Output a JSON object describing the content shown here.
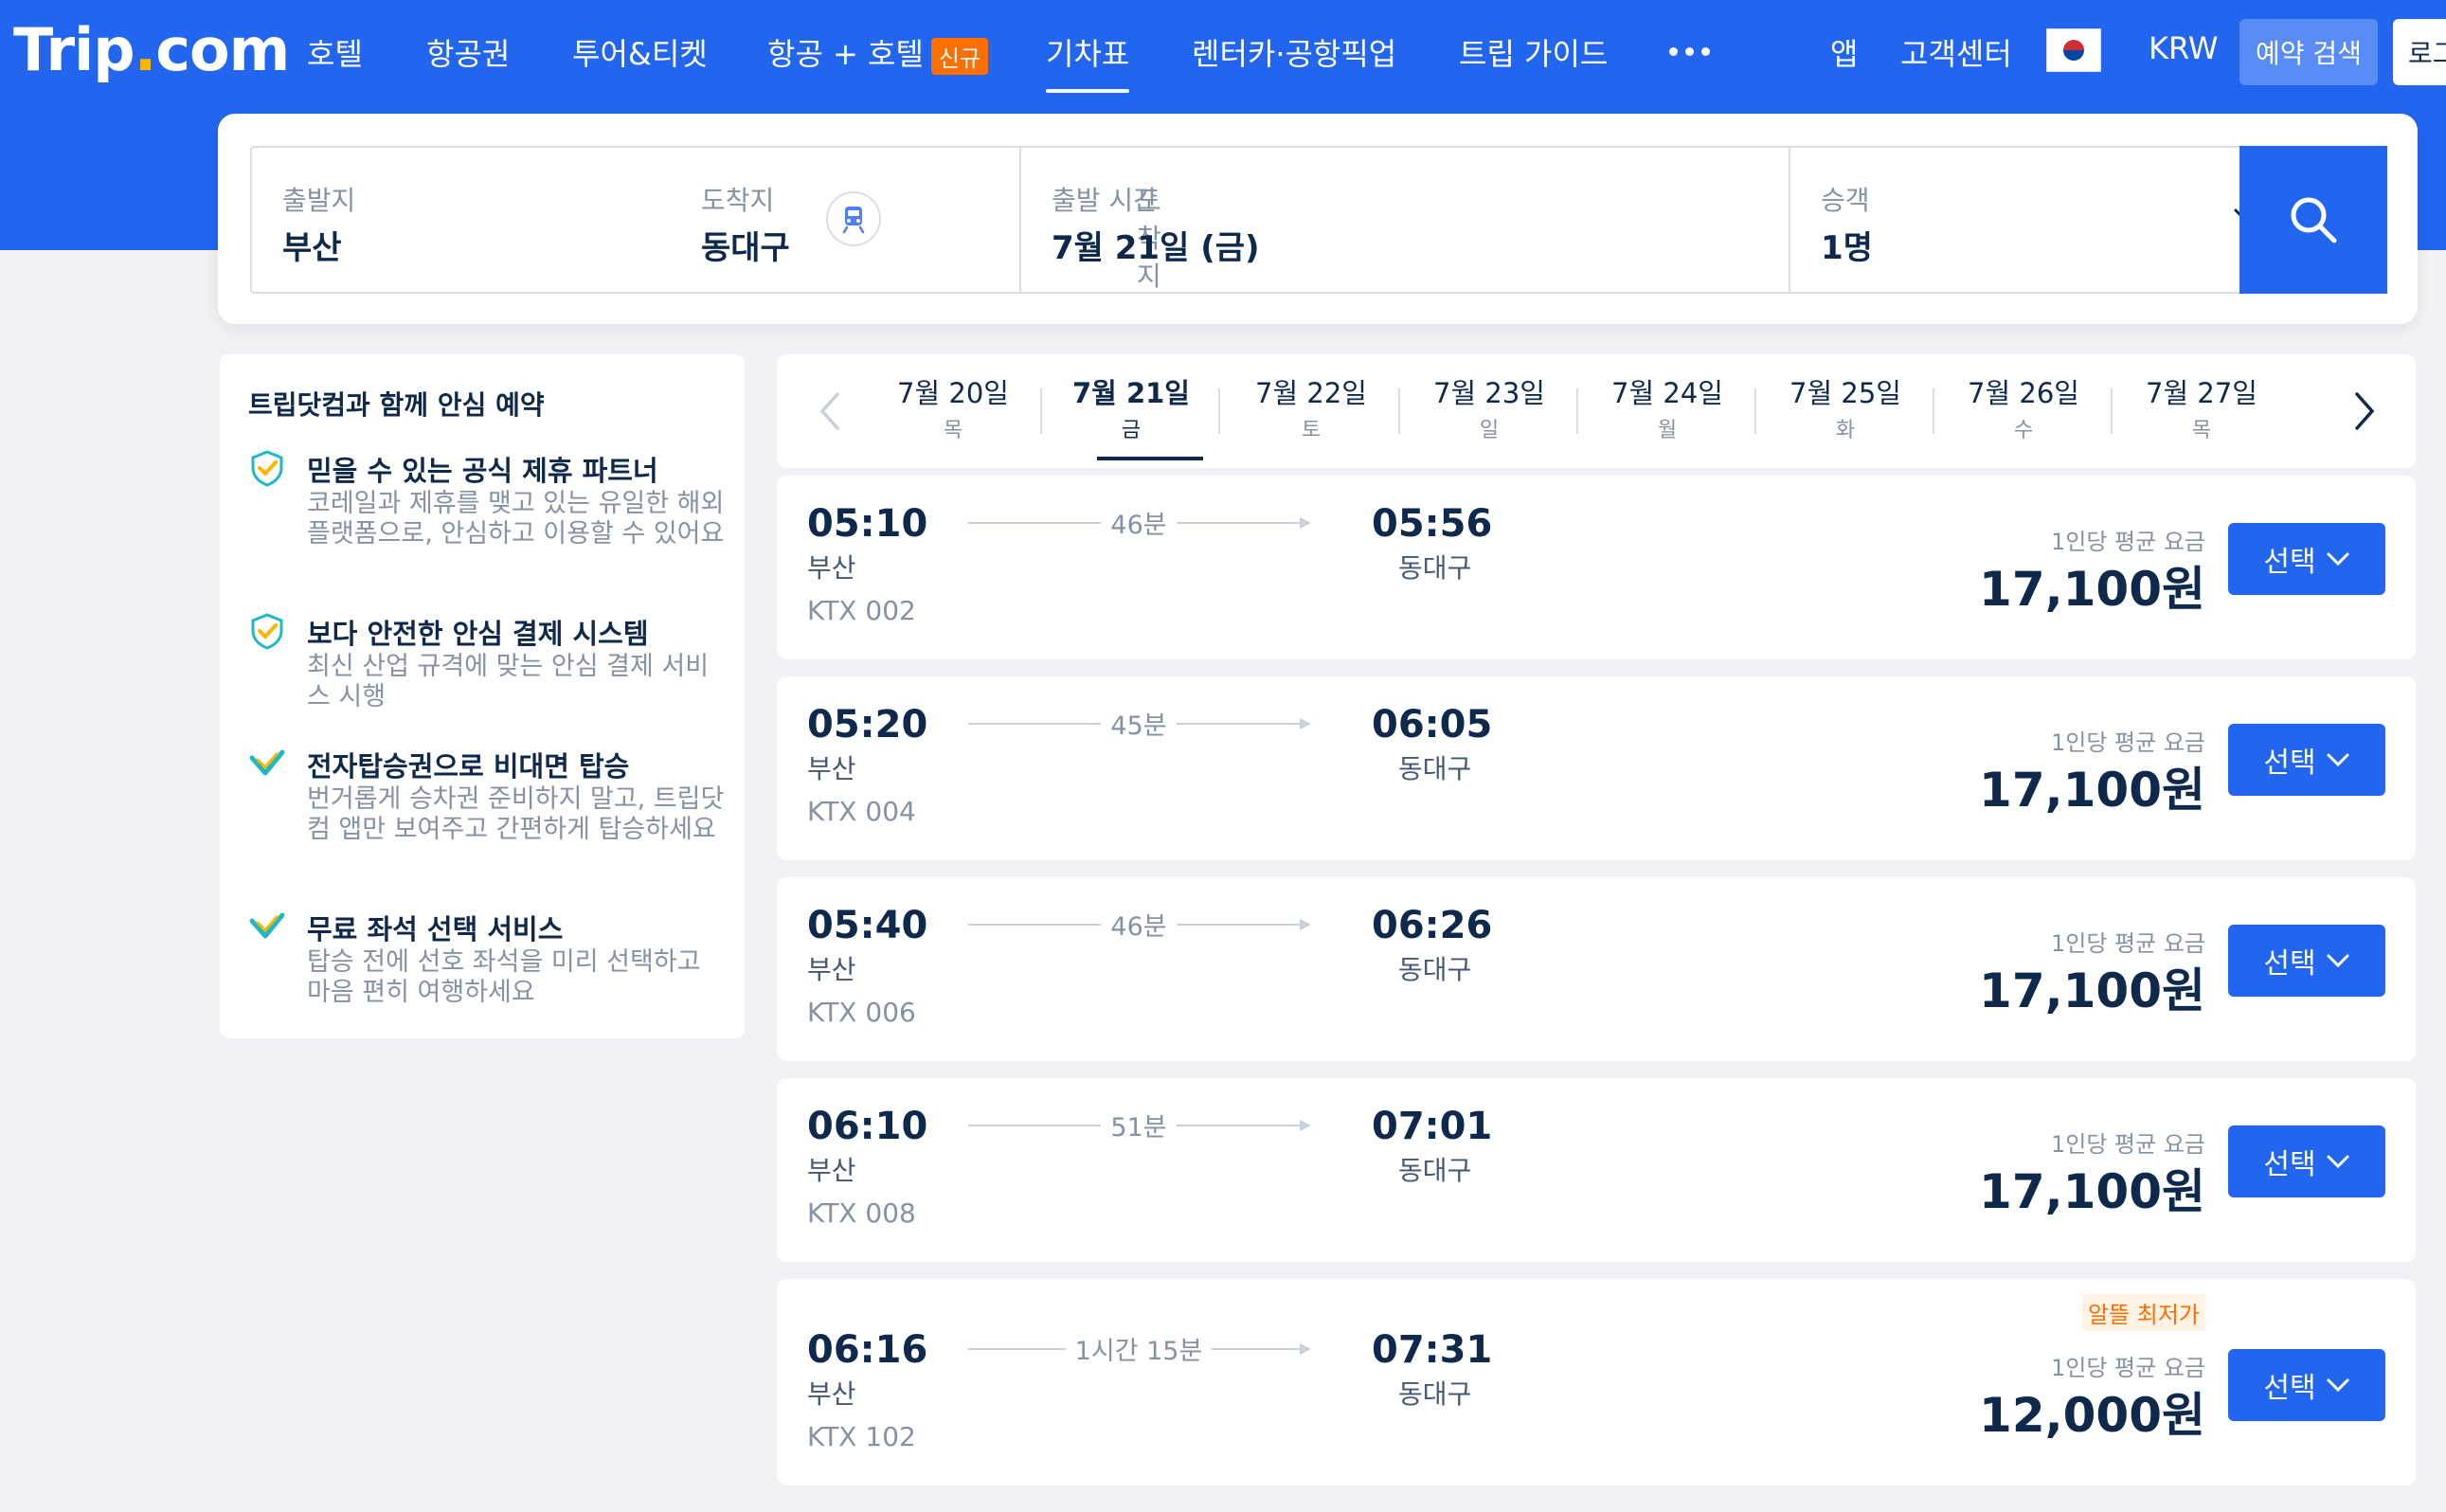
{
  "nav": {
    "logo_text": "Trip",
    "logo_dot": ".",
    "logo_suffix": "com",
    "items": [
      "호텔",
      "항공권",
      "투어&티켓",
      "항공 + 호텔",
      "기차표",
      "렌터카·공항픽업",
      "트립 가이드"
    ],
    "new_badge": "신규",
    "app": "앱",
    "support": "고객센터",
    "currency": "KRW",
    "search_booking": "예약 검색",
    "login": "로그"
  },
  "search": {
    "from_label": "출발지",
    "from_value": "부산",
    "to_label": "도착지",
    "to_value": "동대구",
    "time_label": "출발 시간",
    "time_value": "7월 21일 (금)",
    "pax_label": "승객",
    "pax_value": "1명"
  },
  "info": {
    "title": "트립닷컴과 함께 안심 예약",
    "features": [
      {
        "title": "믿을 수 있는 공식 제휴 파트너",
        "desc": "코레일과 제휴를 맺고 있는 유일한 해외 플랫폼으로, 안심하고 이용할 수 있어요"
      },
      {
        "title": "보다 안전한 안심 결제 시스템",
        "desc": "최신 산업 규격에 맞는 안심 결제 서비스 시행"
      },
      {
        "title": "전자탑승권으로 비대면 탑승",
        "desc": "번거롭게 승차권 준비하지 말고, 트립닷컴 앱만 보여주고 간편하게 탑승하세요"
      },
      {
        "title": "무료 좌석 선택 서비스",
        "desc": "탑승 전에 선호 좌석을 미리 선택하고 마음 편히 여행하세요"
      }
    ]
  },
  "dates": [
    {
      "date": "7월 20일",
      "day": "목"
    },
    {
      "date": "7월 21일",
      "day": "금"
    },
    {
      "date": "7월 22일",
      "day": "토"
    },
    {
      "date": "7월 23일",
      "day": "일"
    },
    {
      "date": "7월 24일",
      "day": "월"
    },
    {
      "date": "7월 25일",
      "day": "화"
    },
    {
      "date": "7월 26일",
      "day": "수"
    },
    {
      "date": "7월 27일",
      "day": "목"
    }
  ],
  "selected_date_index": 1,
  "trains": [
    {
      "dep": "05:10",
      "from": "부산",
      "num": "KTX 002",
      "dur": "46분",
      "arr": "05:56",
      "to": "동대구",
      "avg_label": "1인당 평균 요금",
      "price": "17,100원",
      "btn": "선택",
      "tag": ""
    },
    {
      "dep": "05:20",
      "from": "부산",
      "num": "KTX 004",
      "dur": "45분",
      "arr": "06:05",
      "to": "동대구",
      "avg_label": "1인당 평균 요금",
      "price": "17,100원",
      "btn": "선택",
      "tag": ""
    },
    {
      "dep": "05:40",
      "from": "부산",
      "num": "KTX 006",
      "dur": "46분",
      "arr": "06:26",
      "to": "동대구",
      "avg_label": "1인당 평균 요금",
      "price": "17,100원",
      "btn": "선택",
      "tag": ""
    },
    {
      "dep": "06:10",
      "from": "부산",
      "num": "KTX 008",
      "dur": "51분",
      "arr": "07:01",
      "to": "동대구",
      "avg_label": "1인당 평균 요금",
      "price": "17,100원",
      "btn": "선택",
      "tag": ""
    },
    {
      "dep": "06:16",
      "from": "부산",
      "num": "KTX 102",
      "dur": "1시간 15분",
      "arr": "07:31",
      "to": "동대구",
      "avg_label": "1인당 평균 요금",
      "price": "12,000원",
      "btn": "선택",
      "tag": "알뜰 최저가"
    }
  ],
  "colors": {
    "brand": "#2266f0",
    "accent_orange": "#ff6f00",
    "check_teal": "#1fb8c9",
    "check_yellow": "#ffb400"
  }
}
